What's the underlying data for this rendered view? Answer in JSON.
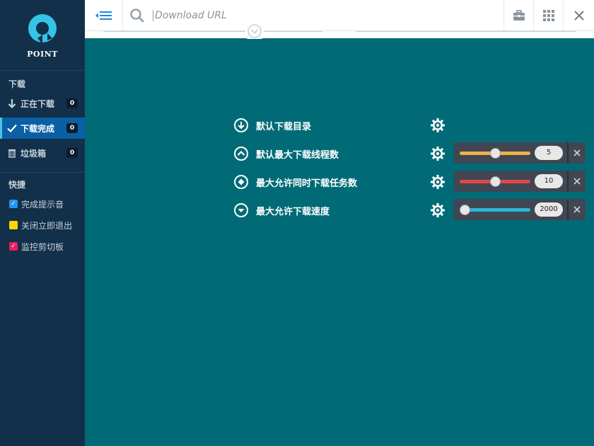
{
  "app": {
    "logo_text": "POINT"
  },
  "sidebar": {
    "download_section": "下载",
    "items": [
      {
        "label": "正在下载",
        "count": "0",
        "icon": "arrow-down-icon"
      },
      {
        "label": "下载完成",
        "count": "0",
        "icon": "check-icon",
        "active": true
      },
      {
        "label": "垃圾箱",
        "count": "0",
        "icon": "trash-icon"
      }
    ],
    "quick_section": "快捷",
    "quick": [
      {
        "label": "完成提示音",
        "color": "#2196f3",
        "checked": true
      },
      {
        "label": "关闭立即退出",
        "color": "#ffd600",
        "checked": false
      },
      {
        "label": "监控剪切板",
        "color": "#e91e63",
        "checked": true
      }
    ]
  },
  "topbar": {
    "url_placeholder": "Download URL"
  },
  "settings": [
    {
      "label": "默认下载目录",
      "icon": "arrow-down-circle-icon"
    },
    {
      "label": "默认最大下载线程数",
      "icon": "chevron-up-circle-icon",
      "slider_color": "#f0b04a",
      "value": "5",
      "slider_fraction": 0.5
    },
    {
      "label": "最大允许同时下载任务数",
      "icon": "diamond-circle-icon",
      "slider_color": "#e04848",
      "value": "10",
      "slider_fraction": 0.5
    },
    {
      "label": "最大允许下载速度",
      "icon": "chevron-down-circle-icon",
      "slider_color": "#29b6d6",
      "value": "2000",
      "slider_fraction": 0.0
    }
  ],
  "colors": {
    "sidebar_bg": "#12304a",
    "main_bg": "#006b77",
    "active_item": "#0b5fa5"
  }
}
